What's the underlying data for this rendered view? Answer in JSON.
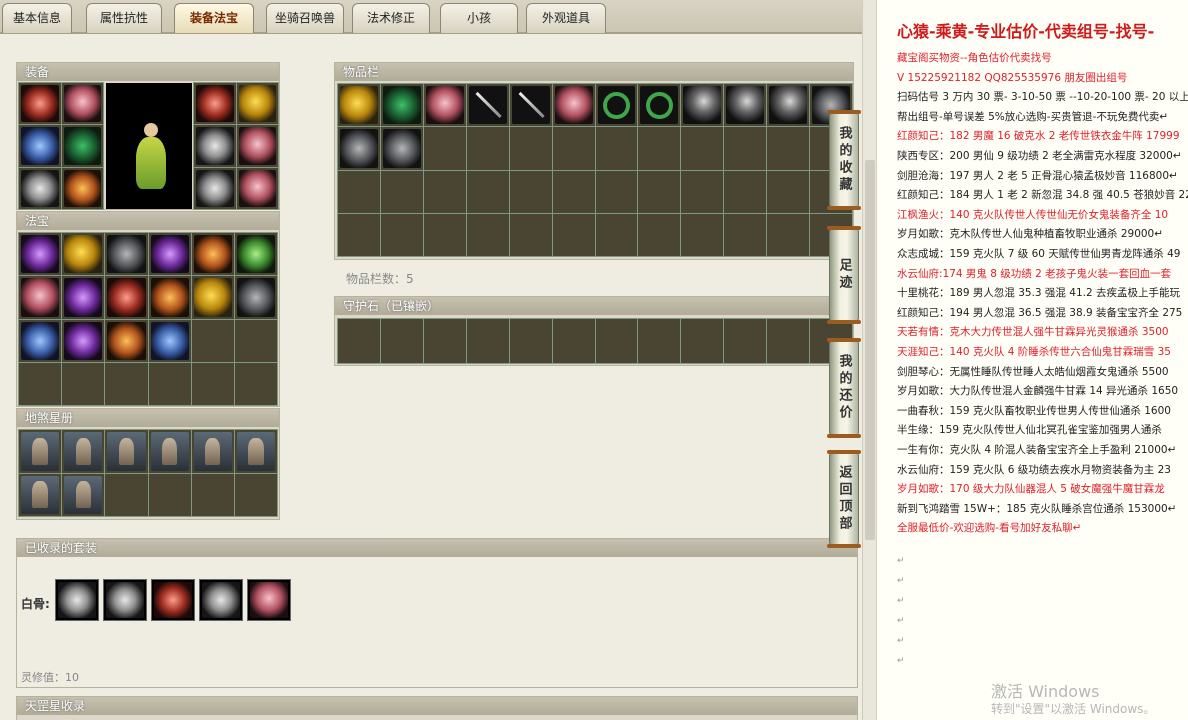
{
  "tabs": [
    "基本信息",
    "属性抗性",
    "装备法宝",
    "坐骑召唤兽",
    "法术修正",
    "小孩",
    "外观道具"
  ],
  "active_tab": "装备法宝",
  "panels": {
    "equip": "装备",
    "fabao": "法宝",
    "disha": "地煞星册",
    "inventory": "物品栏",
    "inventory_count": "物品栏数：5",
    "guard_stone": "守护石（已镶嵌）",
    "suits": "已收录的套装",
    "suit_label": "白骨:",
    "lingxiu": "灵修值：10",
    "tiangang": "天罡星收录"
  },
  "side_buttons": [
    "我的收藏",
    "足迹",
    "我的还价",
    "返回顶部"
  ],
  "doc": {
    "title": "心猿-乘黄-专业估价-代卖组号-找号-",
    "lines": [
      {
        "text": "藏宝阁买物资--角色估价代卖找号",
        "red": true
      },
      {
        "text": "V 15225921182  QQ825535976 朋友圈出组号",
        "red": true
      },
      {
        "text": "扫码估号 3 万内 30 票- 3-10-50 票  --10-20-100 票- 20 以上 1",
        "red": false
      },
      {
        "text": "帮出组号-单号误差 5%放心选购-买贵管退-不玩免费代卖↵",
        "red": false
      },
      {
        "text": "红颜知己：182 男魔 16 破克水 2 老传世铁衣金牛阵 17999",
        "red": true
      },
      {
        "text": "陕西专区：200 男仙 9 级功绩 2 老全满雷克水程度 32000↵",
        "red": false
      },
      {
        "text": "剑胆沧海：197 男人 2 老 5 正骨混心猿孟极妙音 116800↵",
        "red": false
      },
      {
        "text": "红颜知己：184 男人 1 老 2 新忽混 34.8 强 40.5 苍狼妙音 22",
        "red": false
      },
      {
        "text": "江枫渔火：140 克火队传世人传世仙无价女鬼装备齐全 10",
        "red": true
      },
      {
        "text": "岁月如歌：克木队传世人仙鬼种植畜牧职业通杀 29000↵",
        "red": false
      },
      {
        "text": "众志成城：159 克火队 7 级 60 天赋传世仙男青龙阵通杀 49",
        "red": false
      },
      {
        "text": "水云仙府:174 男鬼 8 级功绩 2 老孩子鬼火装一套回血一套",
        "red": true
      },
      {
        "text": "十里桃花：189 男人忽混 35.3 强混 41.2 去疾孟极上手能玩",
        "red": false
      },
      {
        "text": "红颜知己：194 男人忽混 36.5 强混 38.9 装备宝宝齐全 275",
        "red": false
      },
      {
        "text": "天若有情：克木大力传世混人强牛甘霖异光灵猴通杀 3500",
        "red": true
      },
      {
        "text": "天涯知己：140 克火队 4 阶睡杀传世六合仙鬼甘霖瑞雪 35",
        "red": true
      },
      {
        "text": "剑胆琴心：无属性睡队传世睡人太皓仙烟霞女鬼通杀 5500",
        "red": false
      },
      {
        "text": "岁月如歌：大力队传世混人金麟强牛甘霖 14 异光通杀 1650",
        "red": false
      },
      {
        "text": "一曲春秋：159 克火队畜牧职业传世男人传世仙通杀 1600",
        "red": false
      },
      {
        "text": "半生缘：159 克火队传世人仙北冥孔雀宝鉴加强男人通杀",
        "red": false
      },
      {
        "text": "一生有你：克火队 4 阶混人装备宝宝齐全上手盈利 21000↵",
        "red": false
      },
      {
        "text": "水云仙府：159 克火队 6 级功绩去疾水月物资装备为主 23",
        "red": false
      },
      {
        "text": "岁月如歌：170 级大力队仙器混人 5 破女魔强牛魔甘霖龙",
        "red": true
      },
      {
        "text": "新到飞鸿踏雪 15W+：185 克火队睡杀宫位通杀 153000↵",
        "red": false
      },
      {
        "text": "全服最低价-欢迎选购-看号加好友私聊↵",
        "red": true
      }
    ],
    "activate1": "激活 Windows",
    "activate2": "转到\"设置\"以激活 Windows。"
  },
  "colors": {
    "accent_red": "#e0202a",
    "grid_line": "#7c9a82",
    "slot_bg": "#4a4532"
  }
}
